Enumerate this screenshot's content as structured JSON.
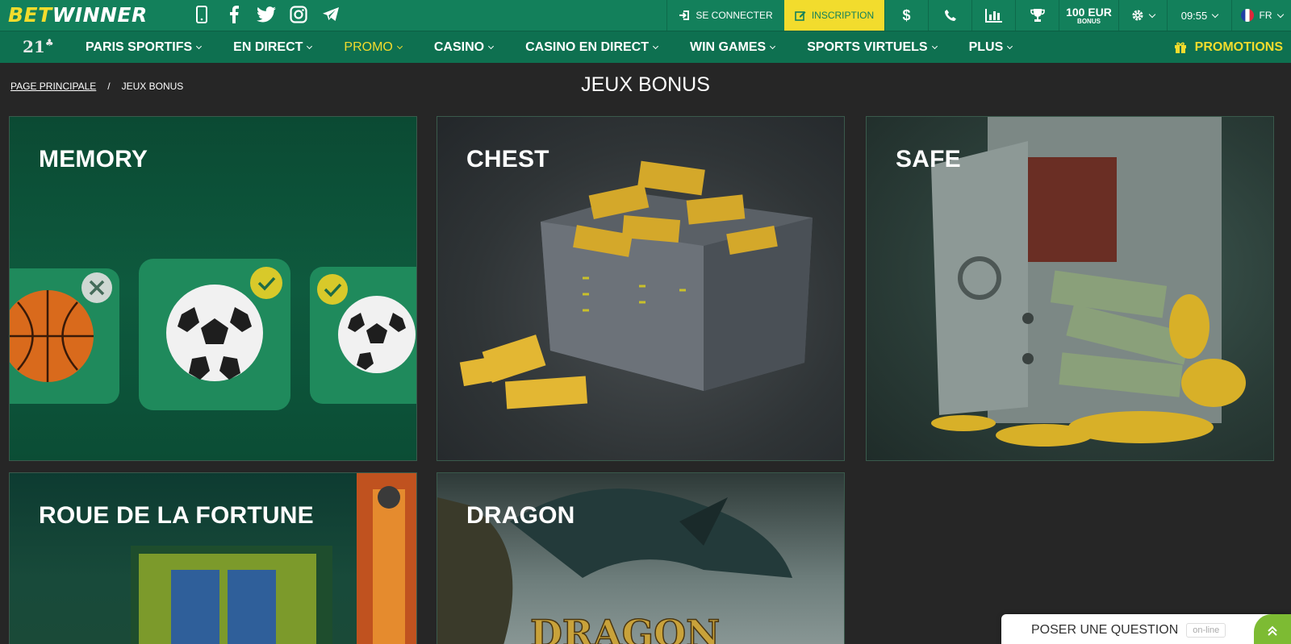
{
  "brand": {
    "part1": "BET",
    "part2": "WINNER"
  },
  "social": [
    "phone-icon",
    "facebook-icon",
    "twitter-icon",
    "instagram-icon",
    "telegram-icon"
  ],
  "topbar": {
    "login_label": "SE CONNECTER",
    "signup_label": "INSCRIPTION",
    "bonus_amount": "100 EUR",
    "bonus_label": "BONUS",
    "time": "09:55",
    "language": "FR"
  },
  "nav": {
    "brand21": "21",
    "items": [
      {
        "label": "PARIS SPORTIFS"
      },
      {
        "label": "EN DIRECT"
      },
      {
        "label": "PROMO"
      },
      {
        "label": "CASINO"
      },
      {
        "label": "CASINO EN DIRECT"
      },
      {
        "label": "WIN GAMES"
      },
      {
        "label": "SPORTS VIRTUELS"
      },
      {
        "label": "PLUS"
      }
    ],
    "promotions_label": "PROMOTIONS"
  },
  "breadcrumb": {
    "home": "PAGE PRINCIPALE",
    "separator": "/",
    "current": "JEUX BONUS"
  },
  "page_title": "JEUX BONUS",
  "games": [
    {
      "title": "MEMORY"
    },
    {
      "title": "CHEST"
    },
    {
      "title": "SAFE"
    },
    {
      "title": "ROUE DE LA FORTUNE"
    },
    {
      "title": "DRAGON"
    }
  ],
  "dragon_art_text": "DRAGON",
  "chat": {
    "label": "POSER UNE QUESTION",
    "status": "on-line"
  },
  "colors": {
    "green": "#13805b",
    "nav_green": "#0e7050",
    "accent_yellow": "#f2dc2d",
    "background": "#262626"
  }
}
